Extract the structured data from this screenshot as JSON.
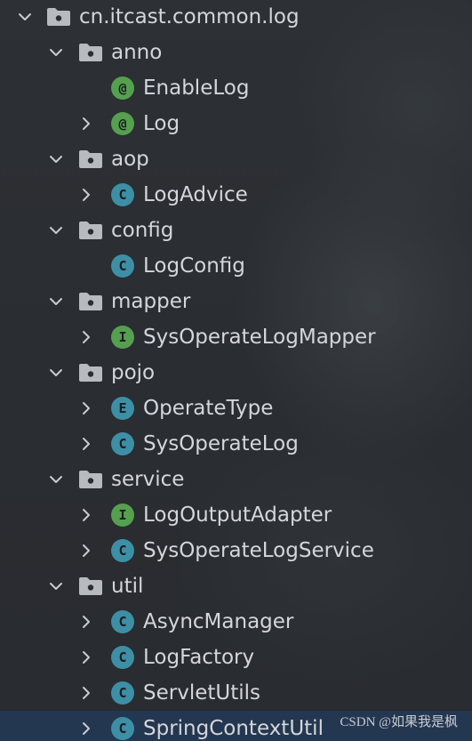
{
  "tree": {
    "root": "cn.itcast.common.log",
    "nodes": [
      {
        "label": "anno",
        "kind": "package",
        "expanded": true,
        "children": [
          {
            "label": "EnableLog",
            "kind": "annotation",
            "badge": "@"
          },
          {
            "label": "Log",
            "kind": "annotation",
            "badge": "@",
            "collapsed": true
          }
        ]
      },
      {
        "label": "aop",
        "kind": "package",
        "expanded": true,
        "children": [
          {
            "label": "LogAdvice",
            "kind": "class",
            "badge": "C",
            "collapsed": true
          }
        ]
      },
      {
        "label": "config",
        "kind": "package",
        "expanded": true,
        "children": [
          {
            "label": "LogConfig",
            "kind": "class",
            "badge": "C"
          }
        ]
      },
      {
        "label": "mapper",
        "kind": "package",
        "expanded": true,
        "children": [
          {
            "label": "SysOperateLogMapper",
            "kind": "interface",
            "badge": "I",
            "collapsed": true
          }
        ]
      },
      {
        "label": "pojo",
        "kind": "package",
        "expanded": true,
        "children": [
          {
            "label": "OperateType",
            "kind": "enum",
            "badge": "E",
            "collapsed": true
          },
          {
            "label": "SysOperateLog",
            "kind": "class",
            "badge": "C",
            "collapsed": true
          }
        ]
      },
      {
        "label": "service",
        "kind": "package",
        "expanded": true,
        "children": [
          {
            "label": "LogOutputAdapter",
            "kind": "interface",
            "badge": "I",
            "collapsed": true
          },
          {
            "label": "SysOperateLogService",
            "kind": "class",
            "badge": "C",
            "collapsed": true
          }
        ]
      },
      {
        "label": "util",
        "kind": "package",
        "expanded": true,
        "children": [
          {
            "label": "AsyncManager",
            "kind": "class",
            "badge": "C",
            "collapsed": true
          },
          {
            "label": "LogFactory",
            "kind": "class",
            "badge": "C",
            "collapsed": true
          },
          {
            "label": "ServletUtils",
            "kind": "class",
            "badge": "C",
            "collapsed": true
          },
          {
            "label": "SpringContextUtil",
            "kind": "class",
            "badge": "C",
            "collapsed": true,
            "selected": true
          }
        ]
      }
    ]
  },
  "watermark": "CSDN @如果我是枫",
  "colors": {
    "background": "#2b2d30",
    "text": "#d4d6da",
    "class_badge": "#3d8fa6",
    "annotation_badge": "#55a04f",
    "folder": "#b7babe",
    "selection": "#21426e"
  },
  "icons": {
    "expand": "chevron-down-icon",
    "collapsed": "chevron-right-icon",
    "package": "package-folder-icon"
  }
}
